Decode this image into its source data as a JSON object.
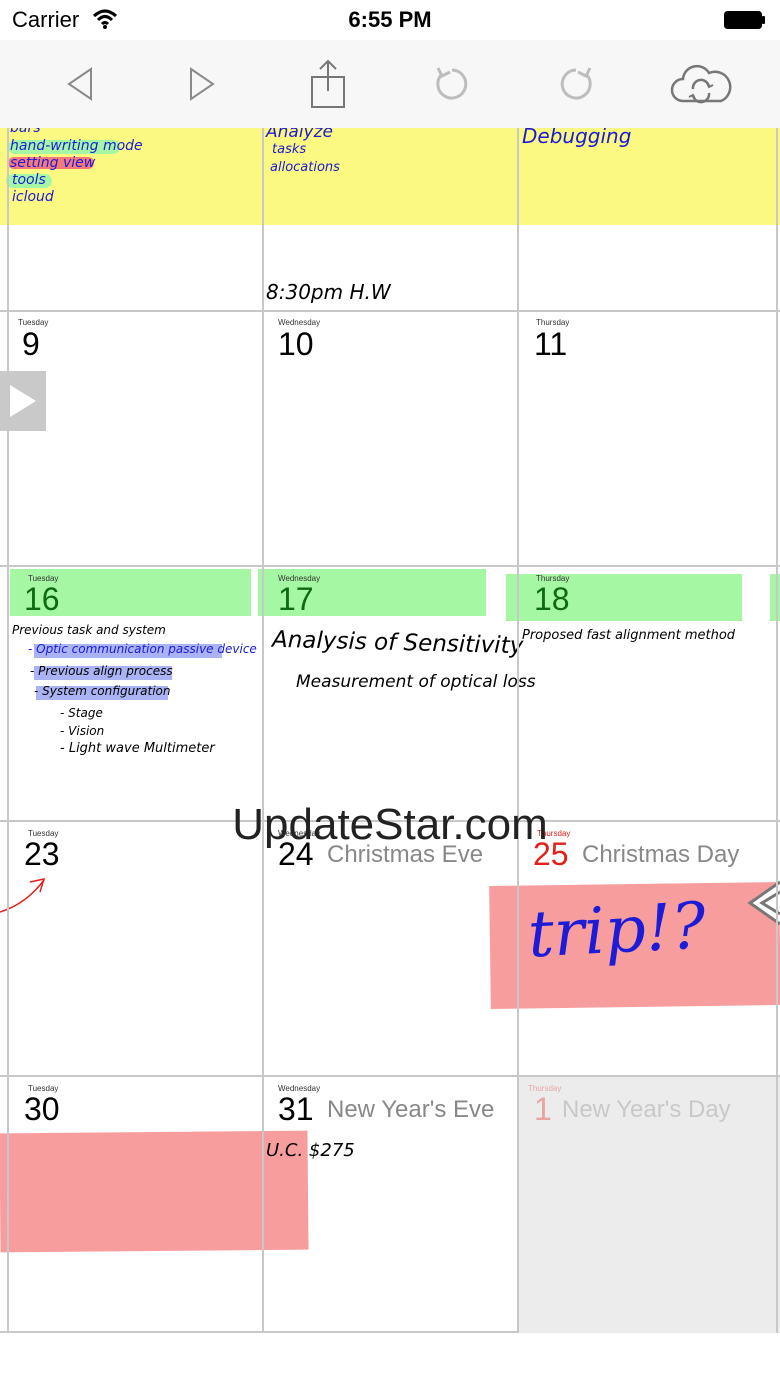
{
  "status_bar": {
    "carrier": "Carrier",
    "time": "6:55 PM"
  },
  "toolbar": {
    "icons": [
      "back-arrow-icon",
      "forward-arrow-icon",
      "share-icon",
      "undo-icon",
      "redo-icon",
      "cloud-sync-icon"
    ]
  },
  "top_row": {
    "col1_notes": [
      "bars",
      "hand-writing mode",
      "setting view",
      "tools",
      "icloud"
    ],
    "col2_notes": [
      "Analyze",
      "tasks",
      "allocations"
    ],
    "col3_notes": [
      "Debugging"
    ],
    "col2_bottom_note": "8:30pm H.W"
  },
  "weeks": [
    {
      "days": [
        {
          "weekday": "Tuesday",
          "number": "9"
        },
        {
          "weekday": "Wednesday",
          "number": "10"
        },
        {
          "weekday": "Thursday",
          "number": "11"
        }
      ]
    },
    {
      "days": [
        {
          "weekday": "Tuesday",
          "number": "16"
        },
        {
          "weekday": "Wednesday",
          "number": "17"
        },
        {
          "weekday": "Thursday",
          "number": "18"
        }
      ],
      "notes": {
        "col1": [
          "Previous task and system",
          "- Optic communication passive device",
          "- Previous align process",
          "- System configuration",
          "- Stage",
          "- Vision",
          "- Light wave Multimeter"
        ],
        "col2": [
          "Analysis of Sensitivity",
          "Measurement of optical loss"
        ],
        "col3": [
          "Proposed fast alignment method"
        ]
      }
    },
    {
      "days": [
        {
          "weekday": "Tuesday",
          "number": "23",
          "holiday": ""
        },
        {
          "weekday": "Wednesday",
          "number": "24",
          "holiday": "Christmas Eve"
        },
        {
          "weekday": "Thursday",
          "number": "25",
          "holiday": "Christmas Day"
        }
      ],
      "notes": {
        "col3": "trip!?"
      }
    },
    {
      "days": [
        {
          "weekday": "Tuesday",
          "number": "30",
          "holiday": ""
        },
        {
          "weekday": "Wednesday",
          "number": "31",
          "holiday": "New Year's Eve"
        },
        {
          "weekday": "Thursday",
          "number": "1",
          "holiday": "New Year's Day"
        }
      ],
      "notes": {
        "col2": "U.C. $275"
      }
    }
  ],
  "watermark": "UpdateStar.com",
  "colors": {
    "yellow_highlight": "#fbf982",
    "green_highlight": "#a6f7a3",
    "red_highlight": "#f89d9d",
    "today_red": "#e0201b",
    "ink_blue": "#1b1bd8",
    "grid_line": "#c8c8c8"
  }
}
